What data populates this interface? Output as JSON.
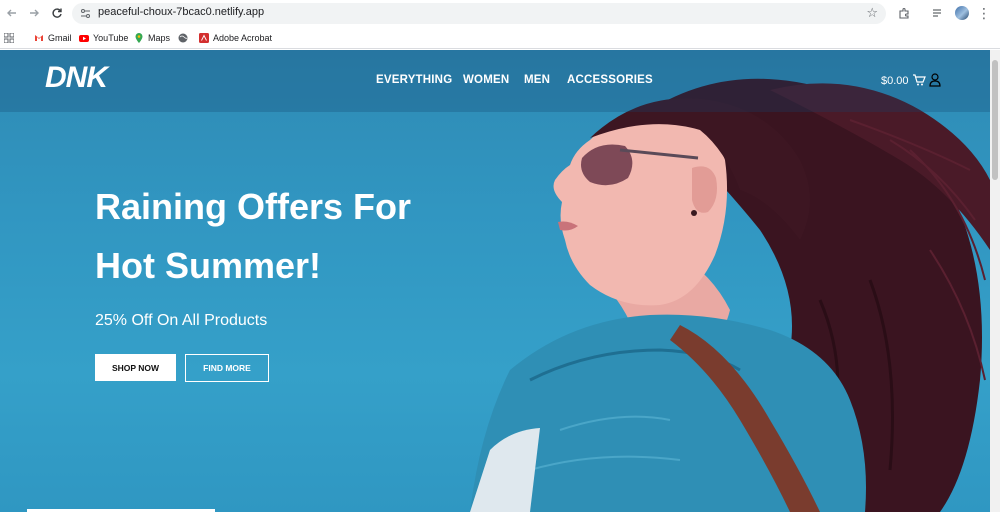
{
  "browser": {
    "url": "peaceful-choux-7bcac0.netlify.app",
    "bookmarks": [
      "Gmail",
      "YouTube",
      "Maps",
      "Adobe Acrobat"
    ]
  },
  "site": {
    "logo": "DNK",
    "nav": [
      "EVERYTHING",
      "WOMEN",
      "MEN",
      "ACCESSORIES"
    ],
    "cart_amount": "$0.00",
    "hero": {
      "headline_line1": "Raining Offers For",
      "headline_line2": "Hot Summer!",
      "subline": "25% Off On All Products",
      "shop_now": "SHOP NOW",
      "find_more": "FIND MORE"
    }
  },
  "colors": {
    "hero_blue": "#3196c1",
    "header_overlay": "#14466e",
    "white": "#ffffff"
  }
}
